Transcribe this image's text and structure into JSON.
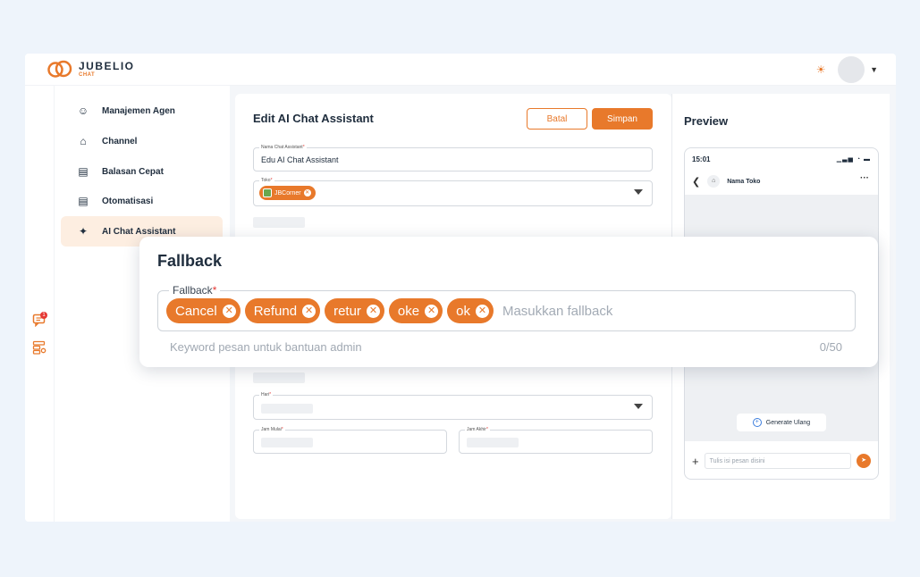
{
  "brand": {
    "name": "JUBELIO",
    "sub": "CHAT",
    "accent": "#e8792b"
  },
  "sidebar": {
    "items": [
      {
        "label": "Manajemen Agen",
        "icon": "agent-icon"
      },
      {
        "label": "Channel",
        "icon": "store-icon"
      },
      {
        "label": "Balasan Cepat",
        "icon": "quick-reply-icon"
      },
      {
        "label": "Otomatisasi",
        "icon": "automation-icon"
      },
      {
        "label": "AI Chat Assistant",
        "icon": "sparkle-icon",
        "active": true
      }
    ]
  },
  "rail": {
    "chat_badge": "1"
  },
  "form": {
    "title": "Edit AI Chat Assistant",
    "batal_label": "Batal",
    "simpan_label": "Simpan",
    "name_label": "Nama Chat Assistant",
    "name_value": "Edu AI Chat Assistant",
    "store_label": "Toko",
    "store_chip": "JBCorner",
    "day_label": "Hari",
    "start_label": "Jam Mulai",
    "end_label": "Jam Akhir",
    "required_mark": "*"
  },
  "preview": {
    "title": "Preview",
    "time": "15:01",
    "status_icons": "▁▃▅ ◔ ▬",
    "shop_name": "Nama Toko",
    "generate_label": "Generate Ulang",
    "message_placeholder": "Tulis isi pesan disini"
  },
  "fallback": {
    "title": "Fallback",
    "label": "Fallback",
    "required_mark": "*",
    "chips": [
      "Cancel",
      "Refund",
      "retur",
      "oke",
      "ok"
    ],
    "placeholder": "Masukkan fallback",
    "helper": "Keyword pesan untuk bantuan admin",
    "counter": "0/50"
  }
}
